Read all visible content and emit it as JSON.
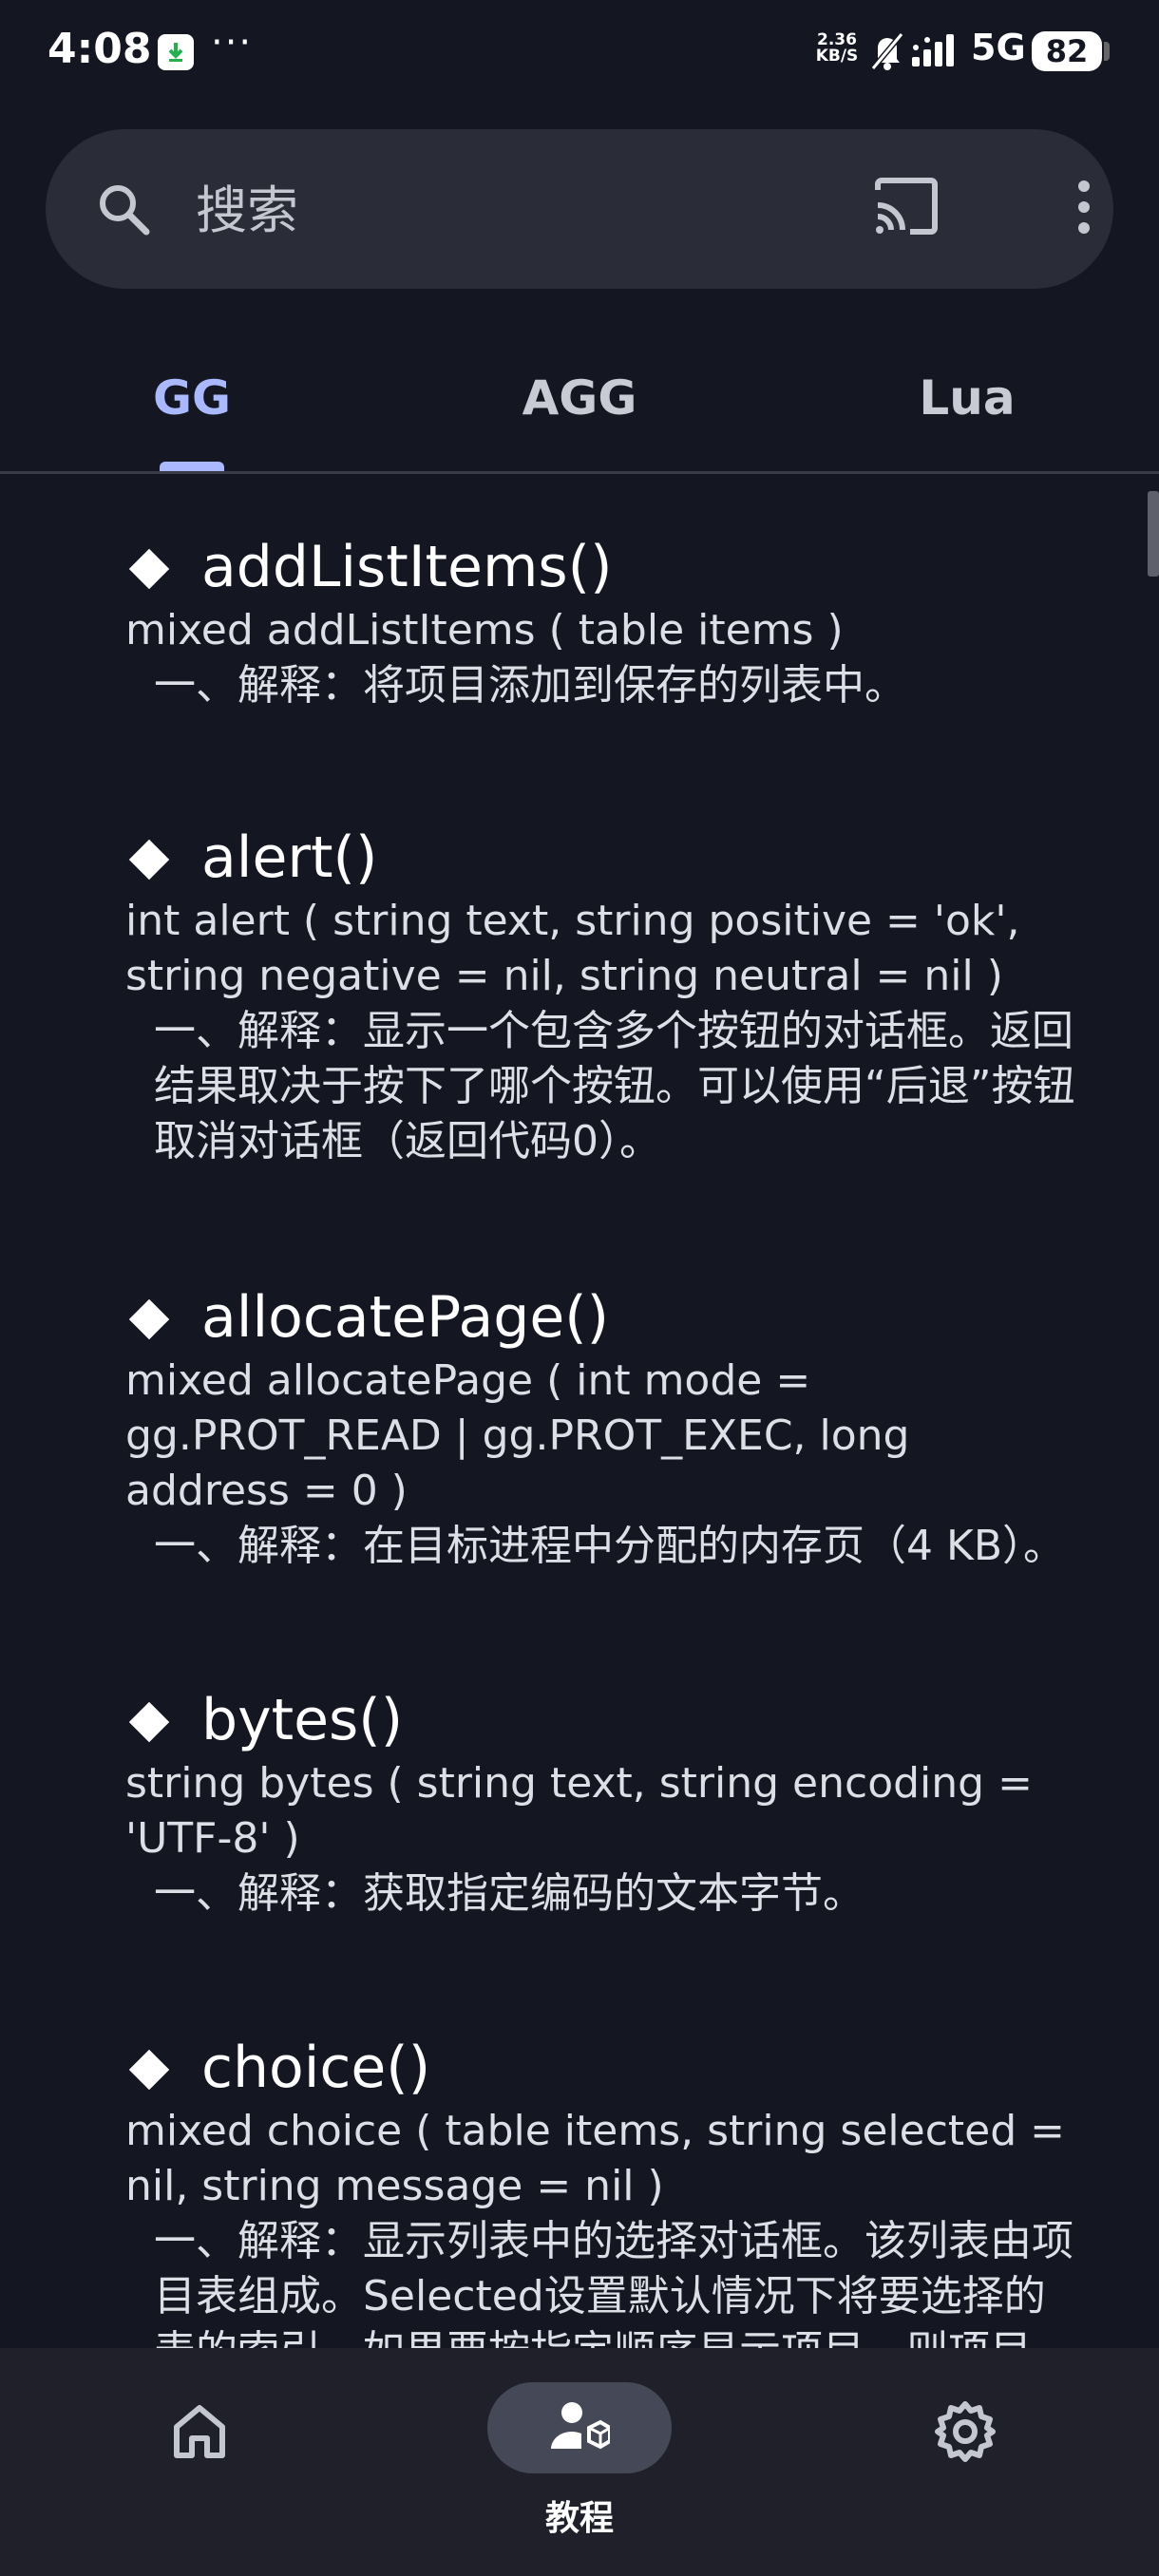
{
  "status_bar": {
    "time": "4:08",
    "more": "···",
    "speed_value": "2.36",
    "speed_unit": "KB/S",
    "network": "5G",
    "battery": "82"
  },
  "search": {
    "placeholder": "搜索"
  },
  "tabs": [
    {
      "label": "GG",
      "active": true
    },
    {
      "label": "AGG",
      "active": false
    },
    {
      "label": "Lua",
      "active": false
    }
  ],
  "entries": [
    {
      "title": "addListItems()",
      "signature": "mixed addListItems ( table items )",
      "description": "一、解释：将项目添加到保存的列表中。"
    },
    {
      "title": "alert()",
      "signature": "int alert ( string text, string positive = 'ok', string negative = nil, string neutral = nil )",
      "description": "一、解释：显示一个包含多个按钮的对话框。返回结果取决于按下了哪个按钮。可以使用“后退”按钮取消对话框（返回代码0）。"
    },
    {
      "title": "allocatePage()",
      "signature": "mixed allocatePage ( int mode = gg.PROT_READ | gg.PROT_EXEC, long address = 0 )",
      "description": "一、解释：在目标进程中分配的内存页（4 KB）。"
    },
    {
      "title": "bytes()",
      "signature": "string bytes ( string text, string encoding = 'UTF-8' )",
      "description": "一、解释：获取指定编码的文本字节。"
    },
    {
      "title": "choice()",
      "signature": "mixed choice ( table items, string selected = nil, string message = nil )",
      "description": "一、解释：显示列表中的选择对话框。该列表由项目表组成。Selected设置默认情况下将要选择的表的索引。如果要按指定顺序显示项目，则项目"
    }
  ],
  "bottom_nav": {
    "home_icon": "home-icon",
    "tutorial_label": "教程",
    "tutorial_icon": "user-cube-icon",
    "settings_icon": "gear-icon",
    "active_bg": "#454957"
  },
  "colors": {
    "background": "#141621",
    "accent": "#a9b8ff",
    "surface": "#2a2d38"
  }
}
